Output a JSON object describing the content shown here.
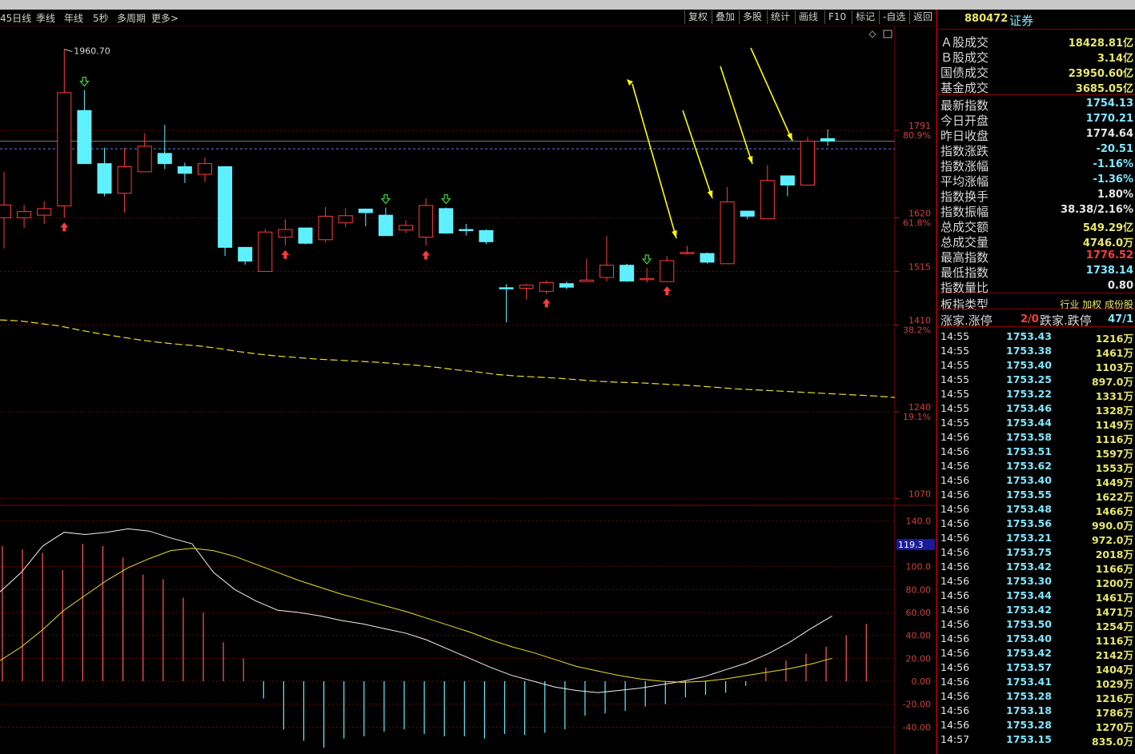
{
  "toolbar": {
    "left_tabs": [
      "45日线",
      "季线",
      "年线",
      "5秒",
      "多周期",
      "更多>"
    ],
    "right_buttons": [
      "复权",
      "叠加",
      "多股",
      "统计",
      "画线",
      "F10",
      "标记",
      "-自选",
      "返回"
    ]
  },
  "chart_data": [
    {
      "type": "candlestick",
      "title": "",
      "y_ticks": [
        {
          "value": 1791,
          "pct": "80.9%"
        },
        {
          "value": 1620,
          "pct": "61.8%"
        },
        {
          "value": 1515,
          "pct": ""
        },
        {
          "value": 1410,
          "pct": "38.2%"
        },
        {
          "value": 1240,
          "pct": "19.1%"
        },
        {
          "value": 1070,
          "pct": ""
        }
      ],
      "ylim": [
        1060,
        1990
      ],
      "high_label": "1960.70",
      "candles": [
        {
          "o": 1620,
          "c": 1645,
          "h": 1710,
          "l": 1560
        },
        {
          "o": 1620,
          "c": 1632,
          "h": 1645,
          "l": 1600
        },
        {
          "o": 1625,
          "c": 1638,
          "h": 1652,
          "l": 1608
        },
        {
          "o": 1643,
          "c": 1865,
          "h": 1950,
          "l": 1620
        },
        {
          "o": 1830,
          "c": 1726,
          "h": 1870,
          "l": 1726
        },
        {
          "o": 1726,
          "c": 1668,
          "h": 1757,
          "l": 1662
        },
        {
          "o": 1668,
          "c": 1720,
          "h": 1757,
          "l": 1630
        },
        {
          "o": 1710,
          "c": 1760,
          "h": 1785,
          "l": 1710
        },
        {
          "o": 1746,
          "c": 1726,
          "h": 1802,
          "l": 1715
        },
        {
          "o": 1720,
          "c": 1707,
          "h": 1728,
          "l": 1688
        },
        {
          "o": 1705,
          "c": 1726,
          "h": 1738,
          "l": 1690
        },
        {
          "o": 1720,
          "c": 1562,
          "h": 1720,
          "l": 1545
        },
        {
          "o": 1562,
          "c": 1535,
          "h": 1562,
          "l": 1528
        },
        {
          "o": 1515,
          "c": 1592,
          "h": 1598,
          "l": 1515
        },
        {
          "o": 1582,
          "c": 1597,
          "h": 1617,
          "l": 1566
        },
        {
          "o": 1600,
          "c": 1570,
          "h": 1600,
          "l": 1568
        },
        {
          "o": 1577,
          "c": 1623,
          "h": 1641,
          "l": 1572
        },
        {
          "o": 1610,
          "c": 1624,
          "h": 1639,
          "l": 1602
        },
        {
          "o": 1637,
          "c": 1630,
          "h": 1638,
          "l": 1603
        },
        {
          "o": 1625,
          "c": 1585,
          "h": 1640,
          "l": 1585
        },
        {
          "o": 1596,
          "c": 1605,
          "h": 1615,
          "l": 1590
        },
        {
          "o": 1582,
          "c": 1644,
          "h": 1658,
          "l": 1565
        },
        {
          "o": 1638,
          "c": 1590,
          "h": 1640,
          "l": 1588
        },
        {
          "o": 1597,
          "c": 1596,
          "h": 1608,
          "l": 1585
        },
        {
          "o": 1595,
          "c": 1573,
          "h": 1597,
          "l": 1568
        },
        {
          "o": 1483,
          "c": 1481,
          "h": 1490,
          "l": 1415
        },
        {
          "o": 1482,
          "c": 1488,
          "h": 1491,
          "l": 1460
        },
        {
          "o": 1476,
          "c": 1493,
          "h": 1497,
          "l": 1471
        },
        {
          "o": 1491,
          "c": 1484,
          "h": 1495,
          "l": 1480
        },
        {
          "o": 1495,
          "c": 1498,
          "h": 1540,
          "l": 1496
        },
        {
          "o": 1503,
          "c": 1527,
          "h": 1584,
          "l": 1495
        },
        {
          "o": 1527,
          "c": 1496,
          "h": 1530,
          "l": 1494
        },
        {
          "o": 1500,
          "c": 1501,
          "h": 1522,
          "l": 1493
        },
        {
          "o": 1495,
          "c": 1536,
          "h": 1545,
          "l": 1495
        },
        {
          "o": 1550,
          "c": 1552,
          "h": 1565,
          "l": 1548
        },
        {
          "o": 1550,
          "c": 1533,
          "h": 1552,
          "l": 1530
        },
        {
          "o": 1530,
          "c": 1651,
          "h": 1680,
          "l": 1530
        },
        {
          "o": 1633,
          "c": 1623,
          "h": 1633,
          "l": 1617
        },
        {
          "o": 1618,
          "c": 1693,
          "h": 1723,
          "l": 1618
        },
        {
          "o": 1702,
          "c": 1684,
          "h": 1702,
          "l": 1662
        },
        {
          "o": 1684,
          "c": 1770,
          "h": 1778,
          "l": 1684
        },
        {
          "o": 1775,
          "c": 1770,
          "h": 1793,
          "l": 1761
        }
      ],
      "ma_line": [
        1420,
        1418,
        1413,
        1408,
        1400,
        1393,
        1387,
        1381,
        1376,
        1372,
        1369,
        1364,
        1358,
        1353,
        1349,
        1346,
        1343,
        1341,
        1339,
        1337,
        1334,
        1331,
        1327,
        1322,
        1318,
        1313,
        1310,
        1308,
        1306,
        1303,
        1300,
        1298,
        1297,
        1295,
        1293,
        1291,
        1288,
        1285,
        1283,
        1281,
        1279,
        1277,
        1275,
        1273,
        1271,
        1268
      ]
    },
    {
      "type": "macd",
      "y_ticks": [
        140.0,
        100.0,
        80.0,
        60.0,
        40.0,
        20.0,
        0.0,
        -20.0,
        -40.0
      ],
      "current_label": "119.3",
      "ylim": [
        -60,
        150
      ],
      "histogram": [
        118,
        115,
        112,
        97,
        120,
        118,
        108,
        93,
        89,
        73,
        60,
        34,
        20,
        -15,
        -42,
        -52,
        -58,
        -50,
        -48,
        -44,
        -42,
        -46,
        -48,
        -48,
        -50,
        -46,
        -47,
        -45,
        -42,
        -30,
        -28,
        -26,
        -22,
        -20,
        -14,
        -12,
        -10,
        -4,
        12,
        18,
        24,
        30,
        40,
        50
      ],
      "dif": [
        78,
        95,
        118,
        130,
        128,
        130,
        133,
        131,
        125,
        120,
        95,
        80,
        70,
        62,
        60,
        57,
        53,
        50,
        46,
        42,
        36,
        28,
        20,
        12,
        5,
        0,
        -5,
        -8,
        -10,
        -8,
        -6,
        -3,
        0,
        4,
        10,
        16,
        24,
        34,
        46,
        57
      ],
      "dea": [
        18,
        30,
        45,
        62,
        75,
        88,
        99,
        107,
        114,
        116,
        114,
        109,
        102,
        95,
        88,
        82,
        76,
        71,
        66,
        61,
        55,
        49,
        43,
        36,
        30,
        25,
        19,
        13,
        9,
        5,
        2,
        0,
        -1,
        0,
        2,
        5,
        8,
        11,
        15,
        20
      ]
    }
  ],
  "panel": {
    "code": "880472",
    "name": "证券",
    "stats": [
      {
        "k": "Ａ股成交",
        "v": "18428.81亿",
        "c": "#e8e86a"
      },
      {
        "k": "Ｂ股成交",
        "v": "3.14亿",
        "c": "#e8e86a"
      },
      {
        "k": "国债成交",
        "v": "23950.60亿",
        "c": "#e8e86a"
      },
      {
        "k": "基金成交",
        "v": "3685.05亿",
        "c": "#e8e86a"
      },
      {
        "k": "最新指数",
        "v": "1754.13",
        "c": "#7fe8ff"
      },
      {
        "k": "今日开盘",
        "v": "1770.21",
        "c": "#7fe8ff"
      },
      {
        "k": "昨日收盘",
        "v": "1774.64",
        "c": "#e6e6e6"
      },
      {
        "k": "指数涨跌",
        "v": "-20.51",
        "c": "#7fe8ff"
      },
      {
        "k": "指数涨幅",
        "v": "-1.16%",
        "c": "#7fe8ff"
      },
      {
        "k": "平均涨幅",
        "v": "-1.36%",
        "c": "#7fe8ff"
      },
      {
        "k": "指数换手",
        "v": "1.80%",
        "c": "#e6e6e6"
      },
      {
        "k": "指数振幅",
        "v": "38.38/2.16%",
        "c": "#e6e6e6"
      },
      {
        "k": "总成交额",
        "v": "549.29亿",
        "c": "#e8e86a"
      },
      {
        "k": "总成交量",
        "v": "4746.0万",
        "c": "#e8e86a"
      },
      {
        "k": "最高指数",
        "v": "1776.52",
        "c": "#ff3b3b"
      },
      {
        "k": "最低指数",
        "v": "1738.14",
        "c": "#7fe8ff"
      },
      {
        "k": "指数量比",
        "v": "0.80",
        "c": "#e6e6e6"
      }
    ],
    "board_type_label": "板指类型",
    "board_type_value": "行业 加权 成份股",
    "up_label": "涨家.涨停",
    "up_value": "2/0",
    "down_label": "跌家.跌停",
    "down_value": "47/1",
    "ticks": [
      {
        "t": "14:55",
        "p": "1753.43",
        "q": "1216万"
      },
      {
        "t": "14:55",
        "p": "1753.38",
        "q": "1461万"
      },
      {
        "t": "14:55",
        "p": "1753.40",
        "q": "1103万"
      },
      {
        "t": "14:55",
        "p": "1753.25",
        "q": "897.0万"
      },
      {
        "t": "14:55",
        "p": "1753.22",
        "q": "1331万"
      },
      {
        "t": "14:55",
        "p": "1753.46",
        "q": "1328万"
      },
      {
        "t": "14:55",
        "p": "1753.44",
        "q": "1149万"
      },
      {
        "t": "14:56",
        "p": "1753.58",
        "q": "1116万"
      },
      {
        "t": "14:56",
        "p": "1753.51",
        "q": "1597万"
      },
      {
        "t": "14:56",
        "p": "1753.62",
        "q": "1553万"
      },
      {
        "t": "14:56",
        "p": "1753.40",
        "q": "1449万"
      },
      {
        "t": "14:56",
        "p": "1753.55",
        "q": "1622万"
      },
      {
        "t": "14:56",
        "p": "1753.48",
        "q": "1466万"
      },
      {
        "t": "14:56",
        "p": "1753.56",
        "q": "990.0万"
      },
      {
        "t": "14:56",
        "p": "1753.21",
        "q": "972.0万"
      },
      {
        "t": "14:56",
        "p": "1753.75",
        "q": "2018万"
      },
      {
        "t": "14:56",
        "p": "1753.42",
        "q": "1166万"
      },
      {
        "t": "14:56",
        "p": "1753.30",
        "q": "1200万"
      },
      {
        "t": "14:56",
        "p": "1753.44",
        "q": "1461万"
      },
      {
        "t": "14:56",
        "p": "1753.42",
        "q": "1471万"
      },
      {
        "t": "14:56",
        "p": "1753.50",
        "q": "1254万"
      },
      {
        "t": "14:56",
        "p": "1753.40",
        "q": "1116万"
      },
      {
        "t": "14:56",
        "p": "1753.42",
        "q": "2142万"
      },
      {
        "t": "14:56",
        "p": "1753.57",
        "q": "1404万"
      },
      {
        "t": "14:56",
        "p": "1753.41",
        "q": "1029万"
      },
      {
        "t": "14:56",
        "p": "1753.28",
        "q": "1216万"
      },
      {
        "t": "14:56",
        "p": "1753.18",
        "q": "1786万"
      },
      {
        "t": "14:56",
        "p": "1753.28",
        "q": "1270万"
      },
      {
        "t": "14:57",
        "p": "1753.15",
        "q": "835.0万"
      }
    ]
  },
  "colors": {
    "up": "#ff3b3b",
    "down": "#5ff0ff",
    "grid": "#7a0000",
    "ma": "#e8e020",
    "arrow": "#ffff00"
  }
}
